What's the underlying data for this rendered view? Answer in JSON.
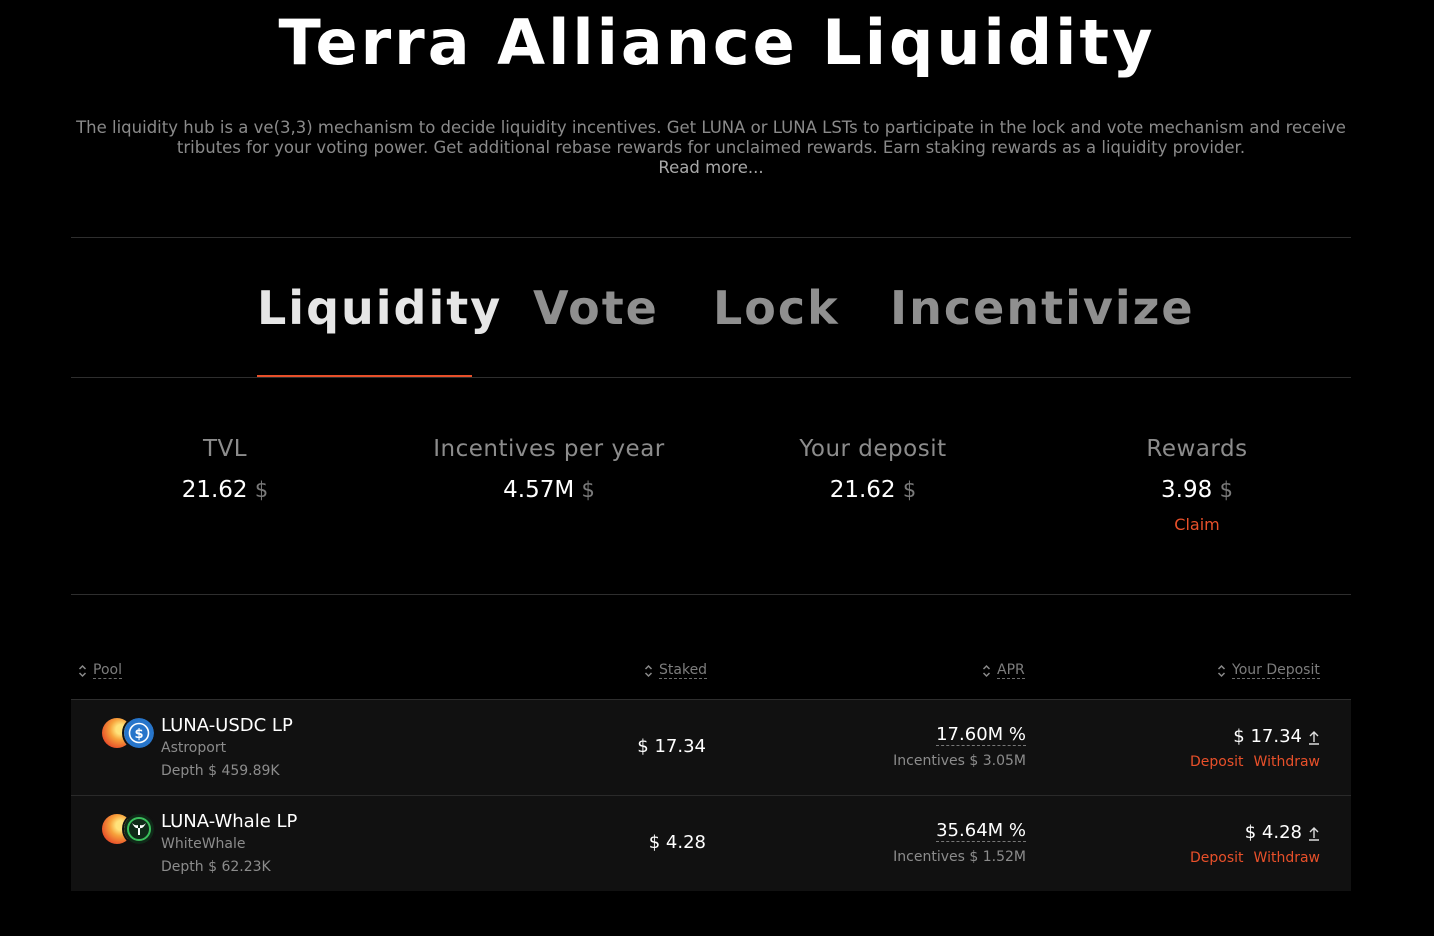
{
  "header": {
    "title": "Terra Alliance Liquidity",
    "description": "The liquidity hub is a ve(3,3) mechanism to decide liquidity incentives. Get LUNA or LUNA LSTs to participate in the lock and vote mechanism and receive tributes for your voting power. Get additional rebase rewards for unclaimed rewards. Earn staking rewards as a liquidity provider.",
    "read_more": "Read more..."
  },
  "tabs": [
    {
      "label": "Liquidity",
      "active": true
    },
    {
      "label": "Vote",
      "active": false
    },
    {
      "label": "Lock",
      "active": false
    },
    {
      "label": "Incentivize",
      "active": false
    }
  ],
  "stats": {
    "tvl": {
      "label": "TVL",
      "value": "21.62",
      "currency": "$"
    },
    "incentives": {
      "label": "Incentives per year",
      "value": "4.57M",
      "currency": "$"
    },
    "deposit": {
      "label": "Your deposit",
      "value": "21.62",
      "currency": "$"
    },
    "rewards": {
      "label": "Rewards",
      "value": "3.98",
      "currency": "$",
      "claim": "Claim"
    }
  },
  "table": {
    "headers": {
      "pool": "Pool",
      "staked": "Staked",
      "apr": "APR",
      "deposit": "Your Deposit"
    },
    "rows": [
      {
        "name": "LUNA-USDC LP",
        "dex": "Astroport",
        "depth": "Depth $ 459.89K",
        "staked": "$ 17.34",
        "apr": "17.60M %",
        "incentives": "Incentives $ 3.05M",
        "deposit": "$ 17.34",
        "deposit_action": "Deposit",
        "withdraw_action": "Withdraw",
        "token_icons": [
          "luna-icon",
          "usdc-icon"
        ]
      },
      {
        "name": "LUNA-Whale LP",
        "dex": "WhiteWhale",
        "depth": "Depth $ 62.23K",
        "staked": "$ 4.28",
        "apr": "35.64M %",
        "incentives": "Incentives $ 1.52M",
        "deposit": "$ 4.28",
        "deposit_action": "Deposit",
        "withdraw_action": "Withdraw",
        "token_icons": [
          "luna-icon",
          "whale-icon"
        ]
      }
    ]
  },
  "colors": {
    "background": "#000000",
    "accent": "#e8502a",
    "muted": "#8c8c8c",
    "usdc": "#2775ca",
    "whale": "#1f7a3a"
  }
}
